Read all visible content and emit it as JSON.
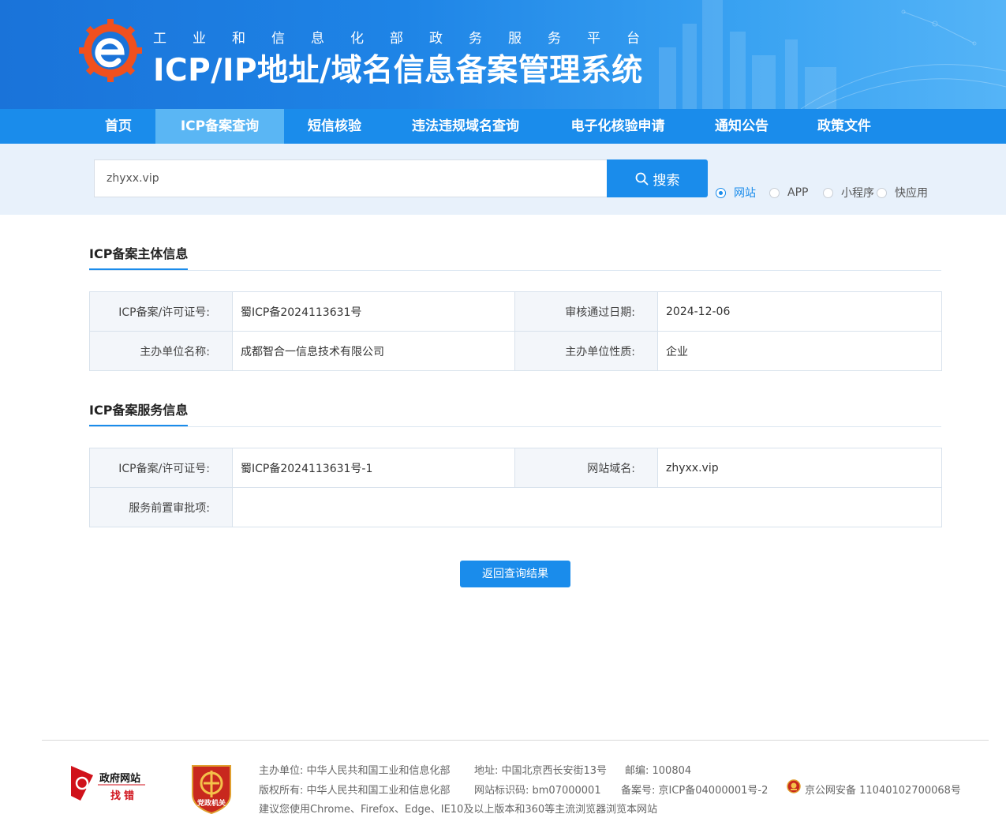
{
  "header": {
    "subtitle": "工业和信息化部政务服务平台",
    "title": "ICP/IP地址/域名信息备案管理系统"
  },
  "nav": {
    "items": [
      {
        "label": "首页"
      },
      {
        "label": "ICP备案查询"
      },
      {
        "label": "短信核验"
      },
      {
        "label": "违法违规域名查询"
      },
      {
        "label": "电子化核验申请"
      },
      {
        "label": "通知公告"
      },
      {
        "label": "政策文件"
      }
    ],
    "active_index": 1
  },
  "search": {
    "value": "zhyxx.vip",
    "button_label": "搜索",
    "options": [
      {
        "label": "网站",
        "checked": true
      },
      {
        "label": "APP",
        "checked": false
      },
      {
        "label": "小程序",
        "checked": false
      },
      {
        "label": "快应用",
        "checked": false
      }
    ]
  },
  "subject": {
    "title": "ICP备案主体信息",
    "license_label": "ICP备案/许可证号:",
    "license_value": "蜀ICP备2024113631号",
    "approval_date_label": "审核通过日期:",
    "approval_date_value": "2024-12-06",
    "org_name_label": "主办单位名称:",
    "org_name_value": "成都智合一信息技术有限公司",
    "org_type_label": "主办单位性质:",
    "org_type_value": "企业"
  },
  "service": {
    "title": "ICP备案服务信息",
    "license_label": "ICP备案/许可证号:",
    "license_value": "蜀ICP备2024113631号-1",
    "domain_label": "网站域名:",
    "domain_value": "zhyxx.vip",
    "preapproval_label": "服务前置审批项:",
    "preapproval_value": ""
  },
  "back_button": "返回查询结果",
  "footer": {
    "gov_badge_line1": "政府网站",
    "gov_badge_line2": "找错",
    "party_badge": "党政机关",
    "organizer": "主办单位: 中华人民共和国工业和信息化部",
    "address": "地址: 中国北京西长安街13号",
    "postcode": "邮编: 100804",
    "copyright": "版权所有: 中华人民共和国工业和信息化部",
    "site_id": "网站标识码: bm07000001",
    "icp": "备案号: 京ICP备04000001号-2",
    "police": "京公网安备 11040102700068号",
    "browser_tip": "建议您使用Chrome、Firefox、Edge、IE10及以上版本和360等主流浏览器浏览本网站"
  },
  "colors": {
    "primary": "#1a8ceb",
    "nav_active": "#5ab6f4",
    "banner_start": "#1a73d9",
    "banner_end": "#55b4f7",
    "logo_orange": "#f0501e"
  }
}
